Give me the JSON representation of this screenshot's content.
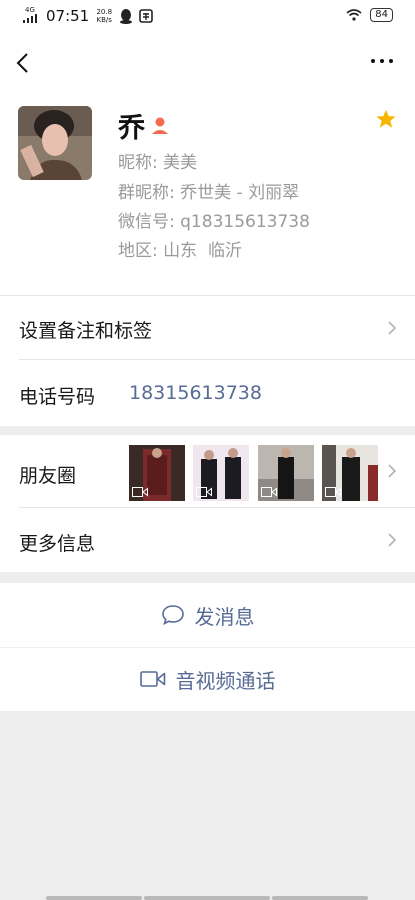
{
  "status_bar": {
    "network": "4G",
    "time": "07:51",
    "speed_value": "20.8",
    "speed_unit": "KB/s",
    "battery": "84"
  },
  "nav": {
    "back_icon": "chevron-left-icon",
    "more_icon": "more-dots-icon"
  },
  "profile": {
    "name": "乔",
    "nickname_label": "昵称:",
    "nickname": "美美",
    "group_nickname_label": "群昵称:",
    "group_nickname": "乔世美 - 刘丽翠",
    "wechat_id_label": "微信号:",
    "wechat_id": "q18315613738",
    "region_label": "地区:",
    "region": "山东  临沂"
  },
  "rows": {
    "remarks_label": "设置备注和标签",
    "phone_label": "电话号码",
    "phone_value": "18315613738",
    "moments_label": "朋友圈",
    "more_info_label": "更多信息"
  },
  "actions": {
    "message_label": "发消息",
    "video_call_label": "音视频通话"
  },
  "colors": {
    "link": "#576b95",
    "star": "#f7b500",
    "badge": "#f26a4f"
  }
}
